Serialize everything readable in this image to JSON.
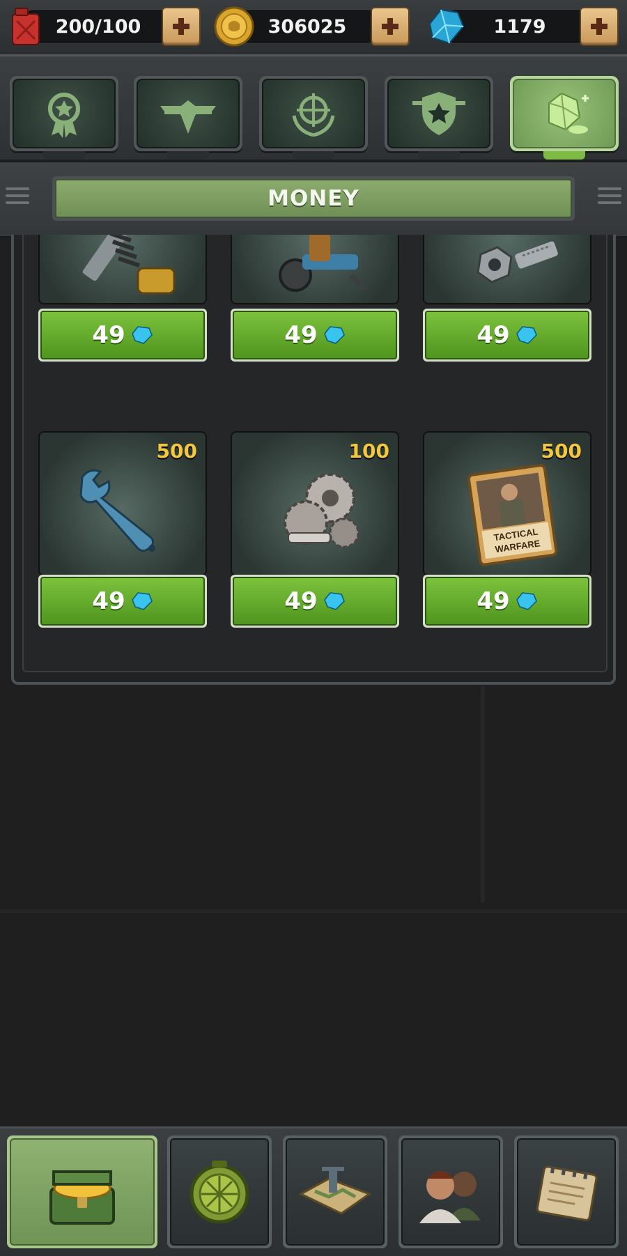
{
  "resources": {
    "fuel": {
      "value": "200/100",
      "icon": "fuel-can-icon"
    },
    "coins": {
      "value": "306025",
      "icon": "gold-coin-icon"
    },
    "gems": {
      "value": "1179",
      "icon": "gem-icon"
    }
  },
  "category_tabs": [
    {
      "icon": "medal-icon",
      "active": false
    },
    {
      "icon": "eagle-icon",
      "active": false
    },
    {
      "icon": "crosshair-icon",
      "active": false
    },
    {
      "icon": "shield-star-icon",
      "active": false
    },
    {
      "icon": "money-icon",
      "active": true
    }
  ],
  "section": {
    "title": "MONEY"
  },
  "shop_items": [
    {
      "item": "spring-parts-icon",
      "count": "",
      "price": "49",
      "currency_icon": "gem-icon"
    },
    {
      "item": "drill-parts-icon",
      "count": "",
      "price": "49",
      "currency_icon": "gem-icon"
    },
    {
      "item": "bolts-icon",
      "count": "",
      "price": "49",
      "currency_icon": "gem-icon"
    },
    {
      "item": "wrench-icon",
      "count": "500",
      "price": "49",
      "currency_icon": "gem-icon"
    },
    {
      "item": "gears-icon",
      "count": "100",
      "price": "49",
      "currency_icon": "gem-icon"
    },
    {
      "item": "tactical-warfare-book-icon",
      "count": "500",
      "price": "49",
      "currency_icon": "gem-icon",
      "book_lines": [
        "TACTICAL",
        "WARFARE"
      ]
    }
  ],
  "bottom_nav": [
    {
      "icon": "treasure-chest-icon",
      "active": true
    },
    {
      "icon": "compass-icon",
      "active": false
    },
    {
      "icon": "map-icon",
      "active": false
    },
    {
      "icon": "soldiers-icon",
      "active": false
    },
    {
      "icon": "notebook-icon",
      "active": false
    }
  ],
  "colors": {
    "accent_green": "#6fae33",
    "count_yellow": "#f3c83f",
    "panel_bg": "#242627"
  }
}
